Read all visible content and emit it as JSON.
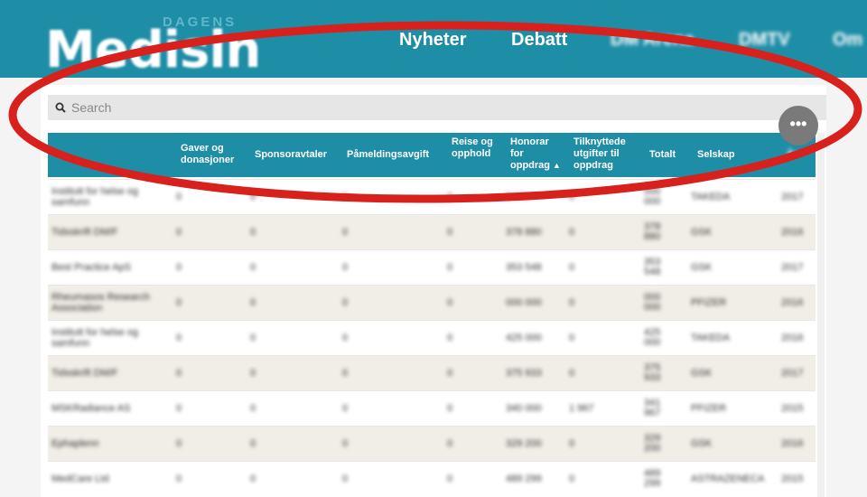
{
  "header": {
    "logo_small": "DAGENS",
    "logo_big": "Medisin",
    "nav": [
      "Nyheter",
      "Debatt",
      "DM Arena",
      "DMTV",
      "Om"
    ]
  },
  "search": {
    "placeholder": "Search"
  },
  "more_button": "•••",
  "table": {
    "columns": [
      "",
      "Gaver og donasjoner",
      "Sponsoravtaler",
      "Påmeldingsavgift",
      "Reise og opphold",
      "Honorar for oppdrag",
      "Tilknyttede utgifter til oppdrag",
      "Totalt",
      "Selskap",
      "År"
    ],
    "sorted_column": "Honorar for oppdrag",
    "rows": [
      [
        "Institutt for helse og samfunn",
        "0",
        "0",
        "0",
        "0",
        "0 000",
        "0",
        "000 000",
        "TAKEDA",
        "2017"
      ],
      [
        "Tidsskrift DM/F",
        "0",
        "0",
        "0",
        "0",
        "378 880",
        "0",
        "378 880",
        "GSK",
        "2016"
      ],
      [
        "Best Practice ApS",
        "0",
        "0",
        "0",
        "0",
        "353 548",
        "0",
        "353 548",
        "GSK",
        "2017"
      ],
      [
        "Rheumasos Research Association",
        "0",
        "0",
        "0",
        "0",
        "000 000",
        "0",
        "000 000",
        "PFIZER",
        "2016"
      ],
      [
        "Institutt for helse og samfunn",
        "0",
        "0",
        "0",
        "0",
        "425 000",
        "0",
        "425 000",
        "TAKEDA",
        "2016"
      ],
      [
        "Tidsskrift DM/F",
        "0",
        "0",
        "0",
        "0",
        "375 933",
        "0",
        "375 933",
        "GSK",
        "2017"
      ],
      [
        "MSKRadiance AS",
        "0",
        "0",
        "0",
        "0",
        "340 000",
        "1 967",
        "341 967",
        "PFIZER",
        "2015"
      ],
      [
        "Ephaplenn",
        "0",
        "0",
        "0",
        "0",
        "329 200",
        "0",
        "329 200",
        "GSK",
        "2016"
      ],
      [
        "MedCare Ltd",
        "0",
        "0",
        "0",
        "0",
        "489 299",
        "0",
        "489 299",
        "ASTRAZENECA",
        "2015"
      ]
    ]
  },
  "annotation_color": "#d8201c",
  "accent_color": "#1e8da6"
}
